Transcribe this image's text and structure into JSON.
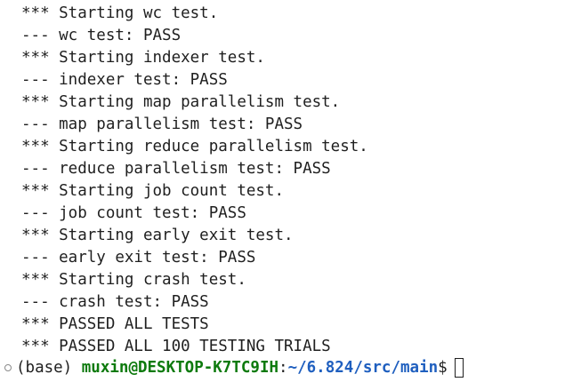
{
  "terminal": {
    "output_lines": [
      "*** Starting wc test.",
      "--- wc test: PASS",
      "*** Starting indexer test.",
      "--- indexer test: PASS",
      "*** Starting map parallelism test.",
      "--- map parallelism test: PASS",
      "*** Starting reduce parallelism test.",
      "--- reduce parallelism test: PASS",
      "*** Starting job count test.",
      "--- job count test: PASS",
      "*** Starting early exit test.",
      "--- early exit test: PASS",
      "*** Starting crash test.",
      "--- crash test: PASS",
      "*** PASSED ALL TESTS",
      "*** PASSED ALL 100 TESTING TRIALS"
    ],
    "prompt": {
      "status_icon": "circle-outline-icon",
      "env": "(base) ",
      "user_host": "muxin@DESKTOP-K7TC9IH",
      "separator": ":",
      "path": "~/6.824/src/main",
      "symbol": "$",
      "input_value": ""
    },
    "colors": {
      "user_host": "#0d7a0d",
      "path": "#1f5fbf",
      "text": "#1f1f1f"
    }
  }
}
